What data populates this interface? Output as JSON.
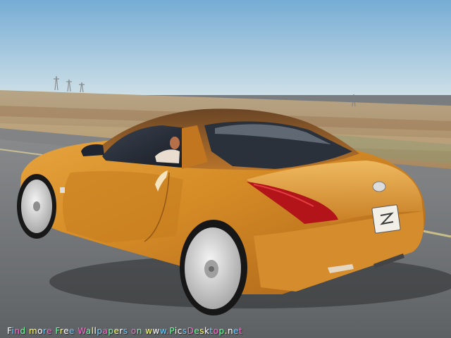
{
  "watermark": {
    "text": "Find more Free Wallpapers on www.PicsDesktop.net",
    "letter_colors": [
      "#ffffff",
      "#66ccff",
      "#ff66cc",
      "#66ff99",
      "#ffff66"
    ]
  },
  "colors": {
    "sky_top": "#7eb4d8",
    "sky_bottom": "#c8dce6",
    "desert": "#b19a78",
    "road": "#6d7074",
    "car_body": "#d99330",
    "car_highlight": "#f3c063",
    "car_shadow_tone": "#8a4f12",
    "taillight": "#b3141a",
    "tire": "#1a1a1a",
    "rim": "#d8d8d8"
  }
}
